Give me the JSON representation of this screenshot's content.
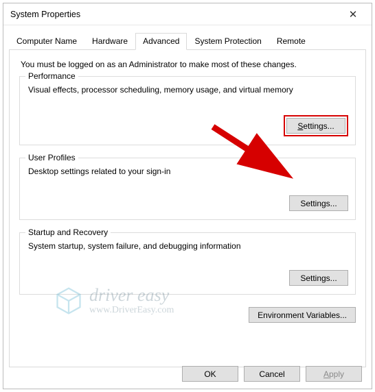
{
  "window": {
    "title": "System Properties"
  },
  "tabs": {
    "items": [
      {
        "label": "Computer Name"
      },
      {
        "label": "Hardware"
      },
      {
        "label": "Advanced"
      },
      {
        "label": "System Protection"
      },
      {
        "label": "Remote"
      }
    ],
    "active_index": 2
  },
  "intro": "You must be logged on as an Administrator to make most of these changes.",
  "groups": {
    "performance": {
      "legend": "Performance",
      "desc": "Visual effects, processor scheduling, memory usage, and virtual memory",
      "button": "Settings..."
    },
    "user_profiles": {
      "legend": "User Profiles",
      "desc": "Desktop settings related to your sign-in",
      "button": "Settings..."
    },
    "startup": {
      "legend": "Startup and Recovery",
      "desc": "System startup, system failure, and debugging information",
      "button": "Settings..."
    }
  },
  "env_button": "Environment Variables...",
  "dialog_buttons": {
    "ok": "OK",
    "cancel": "Cancel",
    "apply": "Apply"
  },
  "watermark": {
    "line1": "driver easy",
    "line2": "www.DriverEasy.com"
  },
  "annotation": {
    "arrow_color": "#d60000",
    "highlight_target": "performance-settings-button"
  }
}
